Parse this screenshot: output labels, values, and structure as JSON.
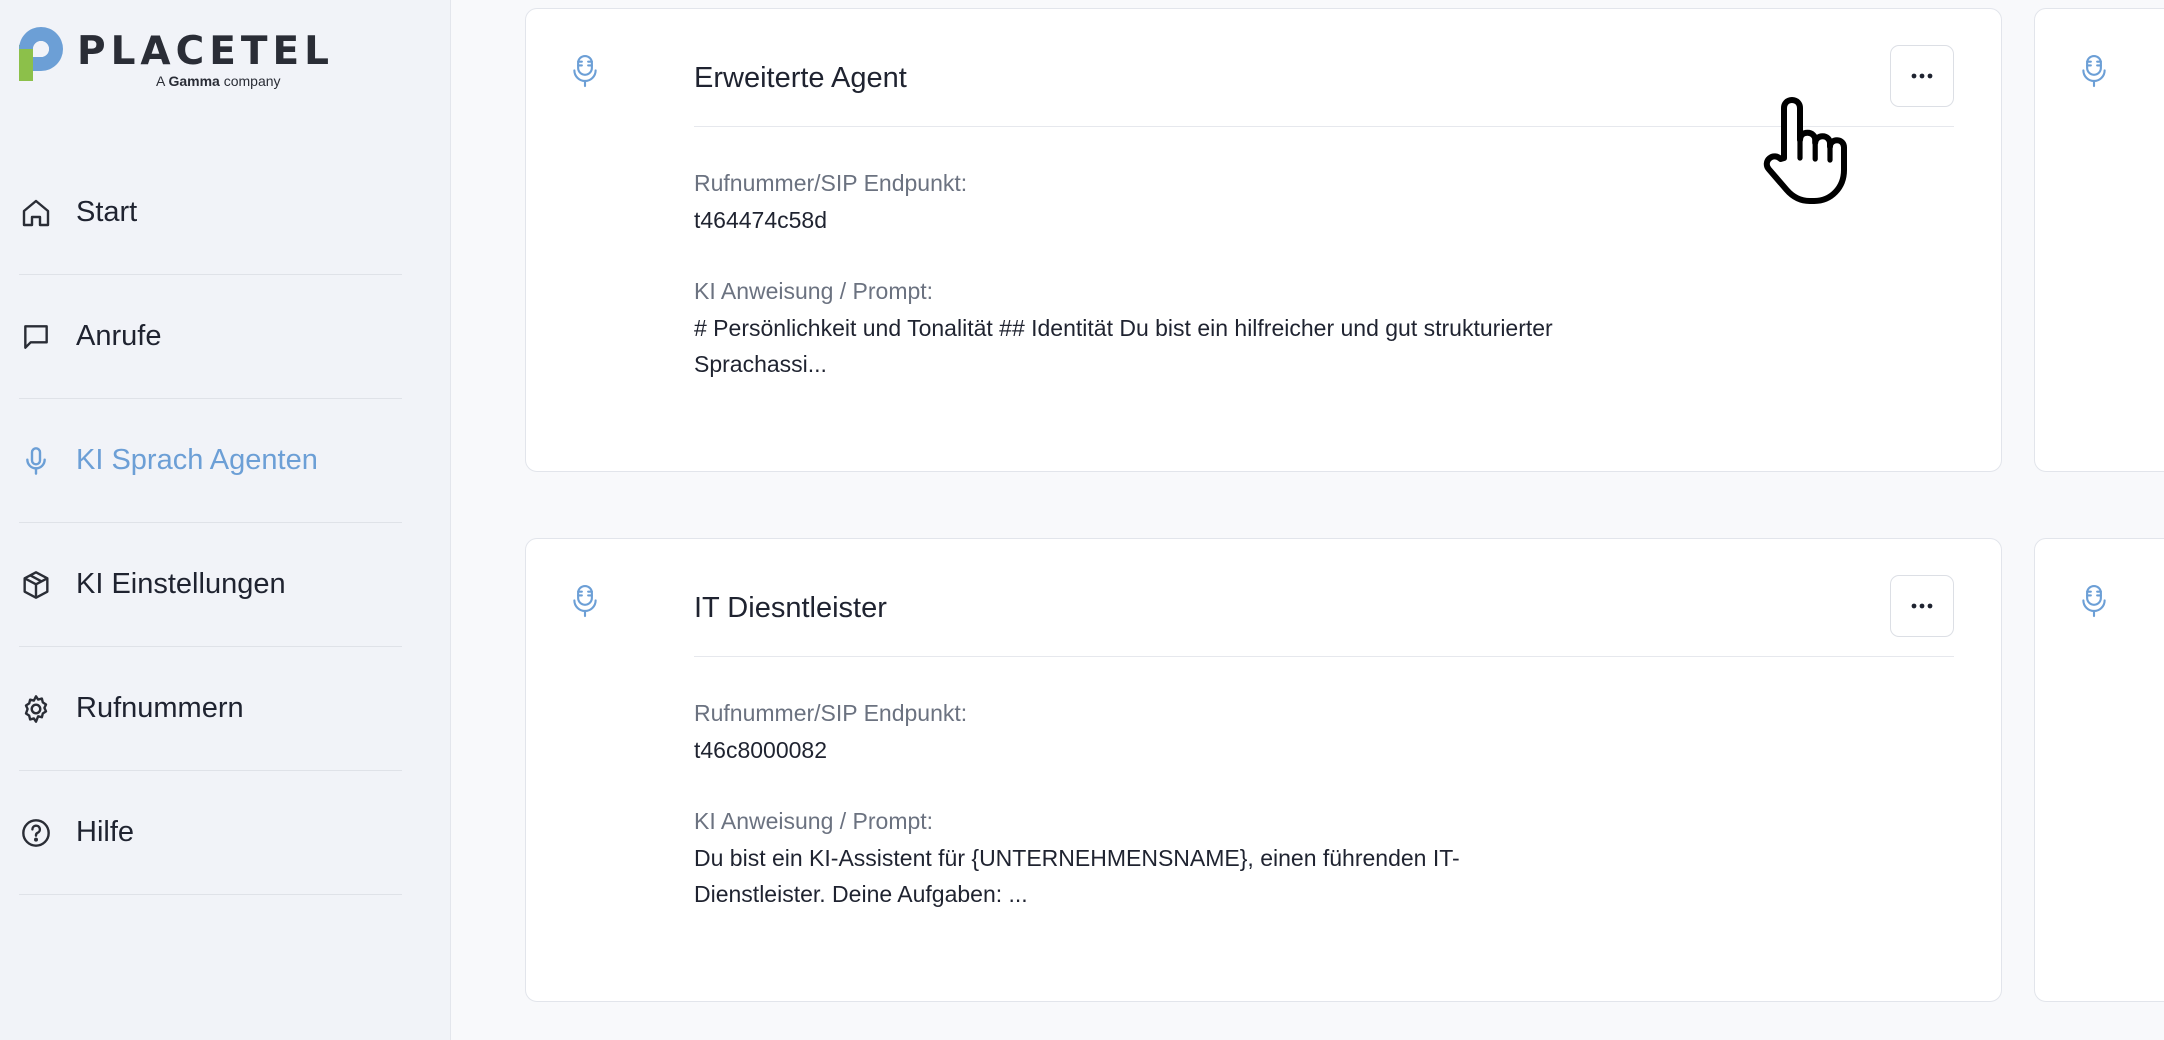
{
  "brand": {
    "name": "PLACETEL",
    "tagline_prefix": "A",
    "tagline_brand": "Gamma",
    "tagline_suffix": "company",
    "colors": {
      "blue": "#6c9fd6",
      "green": "#8cc04a",
      "dark": "#2a2d36"
    }
  },
  "sidebar": {
    "items": [
      {
        "label": "Start",
        "icon": "home-icon",
        "active": false
      },
      {
        "label": "Anrufe",
        "icon": "chat-bubble-icon",
        "active": false
      },
      {
        "label": "KI Sprach Agenten",
        "icon": "microphone-icon",
        "active": true
      },
      {
        "label": "KI Einstellungen",
        "icon": "cube-icon",
        "active": false
      },
      {
        "label": "Rufnummern",
        "icon": "gear-icon",
        "active": false
      },
      {
        "label": "Hilfe",
        "icon": "help-circle-icon",
        "active": false
      }
    ]
  },
  "agents": [
    {
      "title": "Erweiterte Agent",
      "sip_label": "Rufnummer/SIP Endpunkt:",
      "sip_value": "t464474c58d",
      "prompt_label": "KI Anweisung / Prompt:",
      "prompt_value": "# Persönlichkeit und Tonalität ## Identität Du bist ein hilfreicher und gut strukturierter Sprachassi...",
      "icon": "microphone-icon",
      "menu_icon": "more-horizontal-icon"
    },
    {
      "title": "IT Diesntleister",
      "sip_label": "Rufnummer/SIP Endpunkt:",
      "sip_value": "t46c8000082",
      "prompt_label": "KI Anweisung / Prompt:",
      "prompt_value": "Du bist ein KI-Assistent für {UNTERNEHMENSNAME}, einen führenden IT-Dienstleister. Deine Aufgaben: ...",
      "icon": "microphone-icon",
      "menu_icon": "more-horizontal-icon"
    }
  ],
  "accent_color": "#6c9fd6"
}
